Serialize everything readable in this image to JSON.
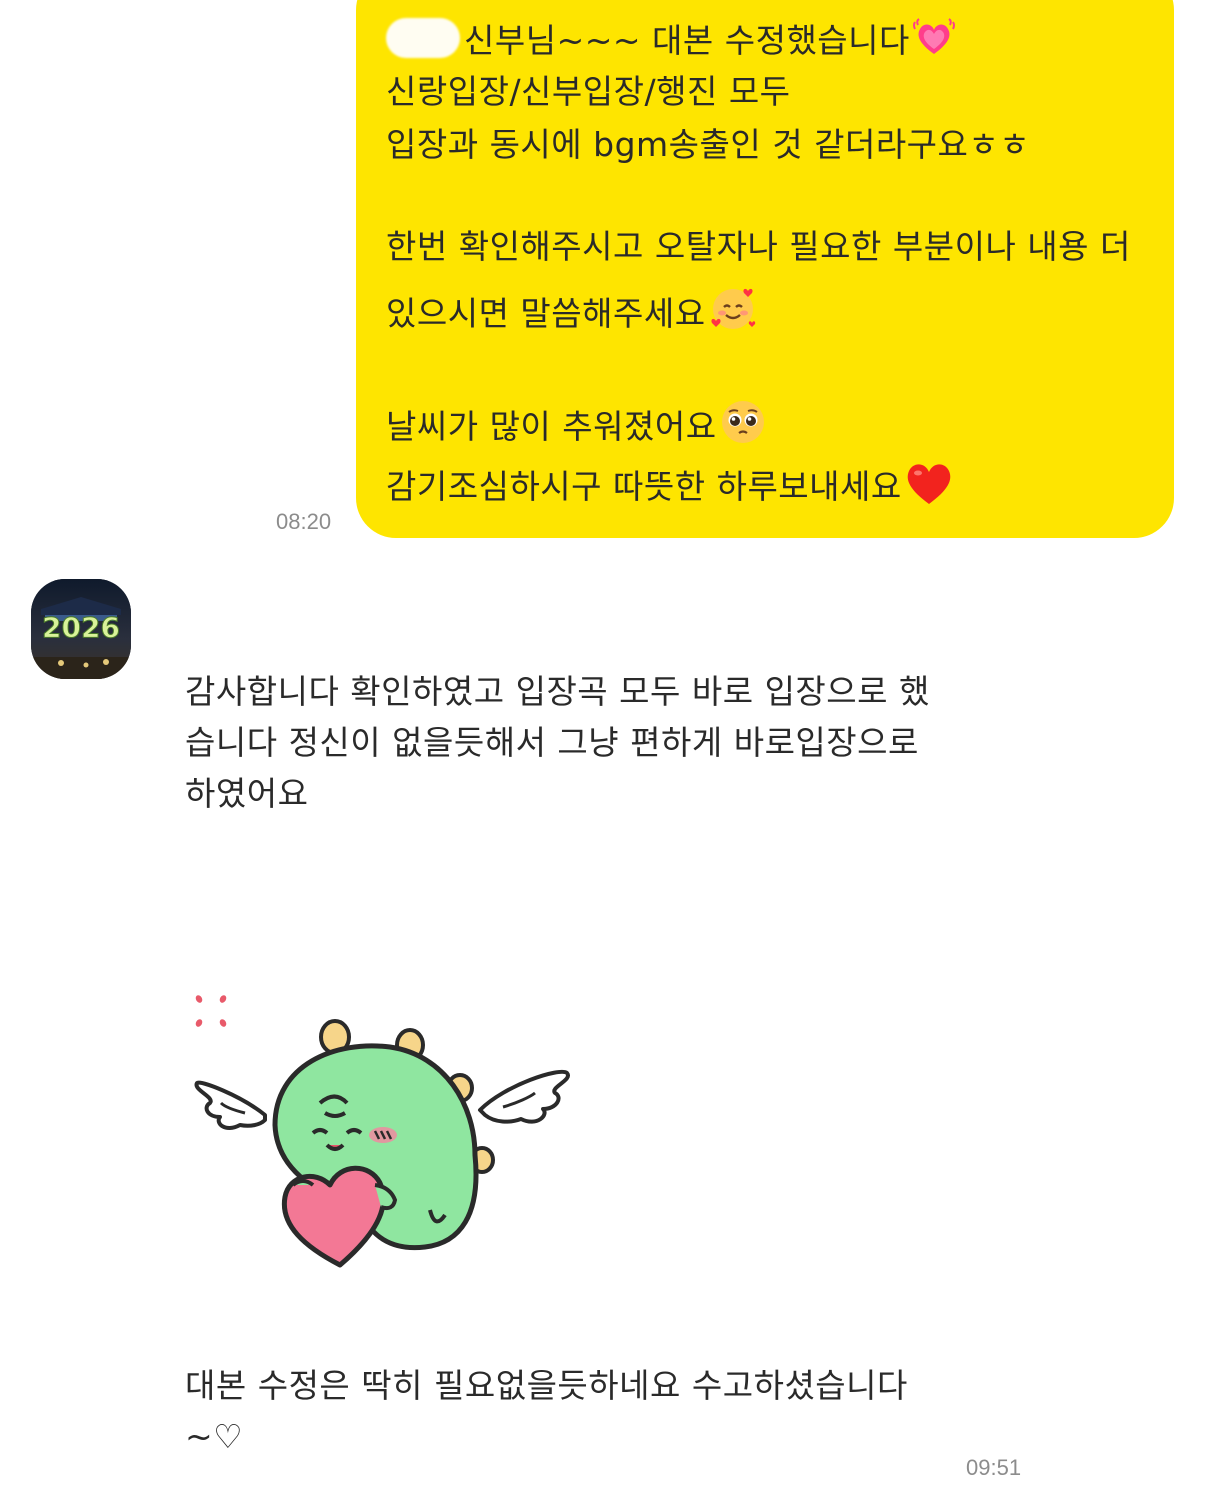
{
  "outgoing": {
    "line1_text": "신부님~~~ 대본 수정했습니다",
    "line2": "신랑입장/신부입장/행진 모두",
    "line3": "입장과 동시에 bgm송출인 것 같더라구요ㅎㅎ",
    "line4": "한번 확인해주시고 오탈자나 필요한 부분이나 내용 더",
    "line5": "있으시면 말씀해주세요",
    "line6": "날씨가 많이 추워졌어요",
    "line7": "감기조심하시구 따뜻한 하루보내세요",
    "time": "08:20",
    "icons": [
      "heart-pulse-emoji",
      "smiling-face-hearts-emoji",
      "pleading-face-emoji",
      "red-heart-emoji"
    ],
    "bubble_color": "#fee500"
  },
  "incoming": {
    "avatar_text": "2026",
    "message1_lines": [
      "감사합니다 확인하였고 입장곡 모두 바로 입장으로 했",
      "습니다 정신이 없을듯해서 그냥 편하게 바로입장으로",
      "하였어요"
    ],
    "sticker": "green-dino-angel-heart-sticker",
    "message2_lines": [
      "대본 수정은 딱히 필요없을듯하네요 수고하셨습니다",
      "~♡"
    ],
    "time": "09:51"
  }
}
